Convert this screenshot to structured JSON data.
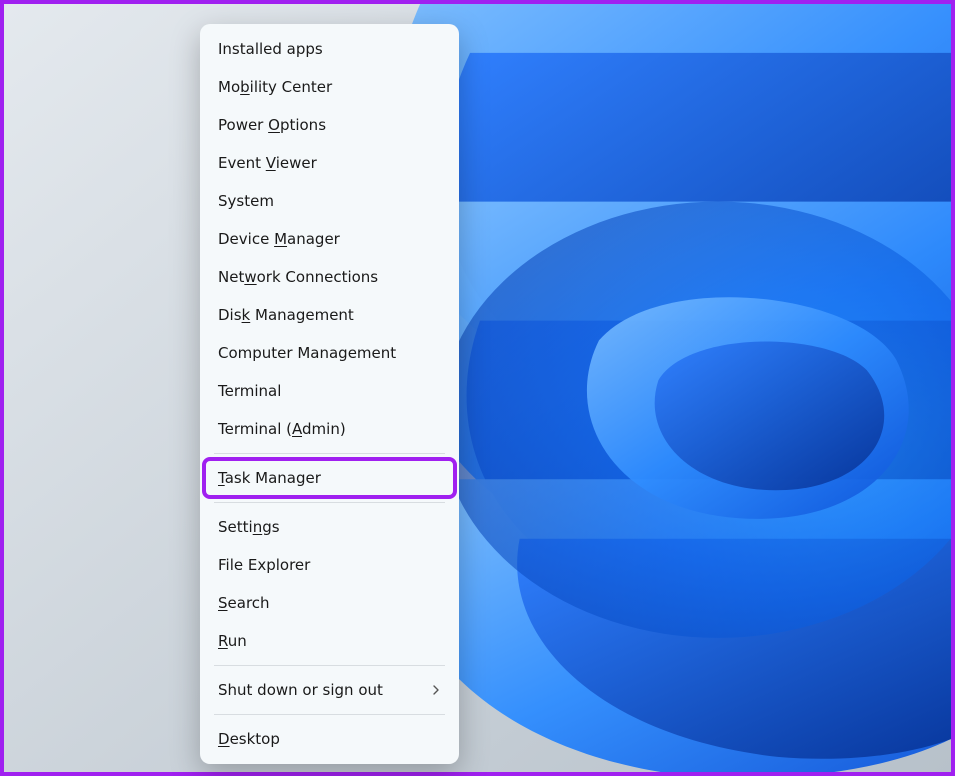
{
  "menu": {
    "items": [
      {
        "label": "Installed apps",
        "accel": "",
        "submenu": false,
        "highlighted": false,
        "divider_after": false
      },
      {
        "label": "Mobility Center",
        "accel": "b",
        "submenu": false,
        "highlighted": false,
        "divider_after": false
      },
      {
        "label": "Power Options",
        "accel": "O",
        "submenu": false,
        "highlighted": false,
        "divider_after": false
      },
      {
        "label": "Event Viewer",
        "accel": "V",
        "submenu": false,
        "highlighted": false,
        "divider_after": false
      },
      {
        "label": "System",
        "accel": "",
        "submenu": false,
        "highlighted": false,
        "divider_after": false
      },
      {
        "label": "Device Manager",
        "accel": "M",
        "submenu": false,
        "highlighted": false,
        "divider_after": false
      },
      {
        "label": "Network Connections",
        "accel": "w",
        "submenu": false,
        "highlighted": false,
        "divider_after": false
      },
      {
        "label": "Disk Management",
        "accel": "k",
        "submenu": false,
        "highlighted": false,
        "divider_after": false
      },
      {
        "label": "Computer Management",
        "accel": "",
        "submenu": false,
        "highlighted": false,
        "divider_after": false
      },
      {
        "label": "Terminal",
        "accel": "",
        "submenu": false,
        "highlighted": false,
        "divider_after": false
      },
      {
        "label": "Terminal (Admin)",
        "accel": "A",
        "submenu": false,
        "highlighted": false,
        "divider_after": true
      },
      {
        "label": "Task Manager",
        "accel": "T",
        "submenu": false,
        "highlighted": true,
        "divider_after": true
      },
      {
        "label": "Settings",
        "accel": "n",
        "submenu": false,
        "highlighted": false,
        "divider_after": false
      },
      {
        "label": "File Explorer",
        "accel": "",
        "submenu": false,
        "highlighted": false,
        "divider_after": false
      },
      {
        "label": "Search",
        "accel": "S",
        "submenu": false,
        "highlighted": false,
        "divider_after": false
      },
      {
        "label": "Run",
        "accel": "R",
        "submenu": false,
        "highlighted": false,
        "divider_after": true
      },
      {
        "label": "Shut down or sign out",
        "accel": "",
        "submenu": true,
        "highlighted": false,
        "divider_after": true
      },
      {
        "label": "Desktop",
        "accel": "D",
        "submenu": false,
        "highlighted": false,
        "divider_after": false
      }
    ]
  },
  "colors": {
    "highlight_border": "#a020f0",
    "menu_bg": "#f5f9fb",
    "menu_text": "#1a1a1a"
  }
}
